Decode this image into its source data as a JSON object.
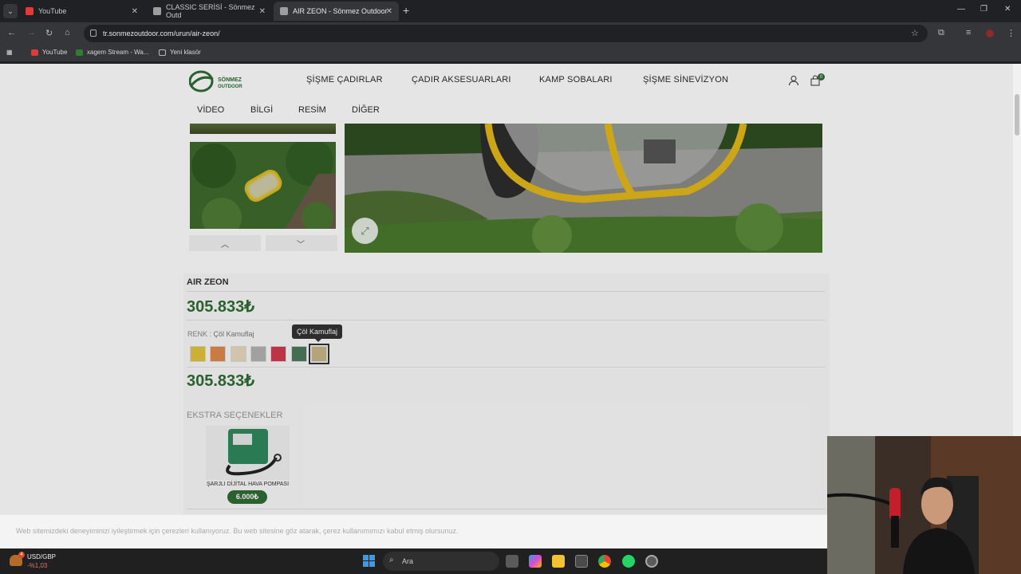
{
  "browser": {
    "tabs": [
      {
        "title": "YouTube",
        "active": false,
        "color": "#e53935"
      },
      {
        "title": "CLASSIC SERİSİ - Sönmez Outd",
        "active": false,
        "color": "#9e9e9e"
      },
      {
        "title": "AIR ZEON - Sönmez Outdoor",
        "active": true,
        "color": "#9e9e9e"
      }
    ],
    "url": "tr.sonmezoutdoor.com/urun/air-zeon/",
    "bookmarks": [
      {
        "label": "YouTube",
        "color": "#e53935"
      },
      {
        "label": "xagem Stream - Wa...",
        "color": "#2e7d32"
      },
      {
        "label": "Yeni klasör",
        "color": "#888888"
      }
    ]
  },
  "site": {
    "logo_text": "SÖNMEZ OUTDOOR",
    "menu": [
      "ŞİŞME ÇADIRLAR",
      "ÇADIR AKSESUARLARI",
      "KAMP SOBALARI",
      "ŞİŞME SİNEVİZYON"
    ],
    "subnav": [
      "VİDEO",
      "BİLGİ",
      "RESİM",
      "DİĞER"
    ],
    "cart_count": "0",
    "accent": "#2f6d34"
  },
  "product": {
    "title": "AIR ZEON",
    "price": "305.833₺",
    "price2": "305.833₺",
    "color_label": "RENK : ",
    "color_value": "Çöl Kamuflaj",
    "tooltip": "Çöl Kamuflaj",
    "swatches": [
      {
        "name": "Sarı",
        "hex": "#e3c53c"
      },
      {
        "name": "Turuncu",
        "hex": "#e08a4a"
      },
      {
        "name": "Bej",
        "hex": "#e8dcc0"
      },
      {
        "name": "Gri",
        "hex": "#b4b4b4"
      },
      {
        "name": "Kırmızı",
        "hex": "#d23a4f"
      },
      {
        "name": "Yeşil",
        "hex": "#4d7a5e"
      },
      {
        "name": "Çöl Kamuflaj",
        "hex": "#c9b78a",
        "selected": true
      }
    ],
    "extras_title": "EKSTRA SEÇENEKLER",
    "extras": [
      {
        "name": "ŞARJLI DİJİTAL HAVA POMPASI",
        "price": "6.000₺"
      }
    ]
  },
  "cookie_text": "Web sitemizdeki deneyiminizi iyileştirmek için çerezleri kullanıyoruz. Bu web sitesine göz atarak, çerez kullanımımızı kabul etmiş olursunuz.",
  "taskbar": {
    "ticker": "USD/GBP",
    "change": "-%1,03",
    "search_placeholder": "Ara",
    "badge": "4"
  }
}
